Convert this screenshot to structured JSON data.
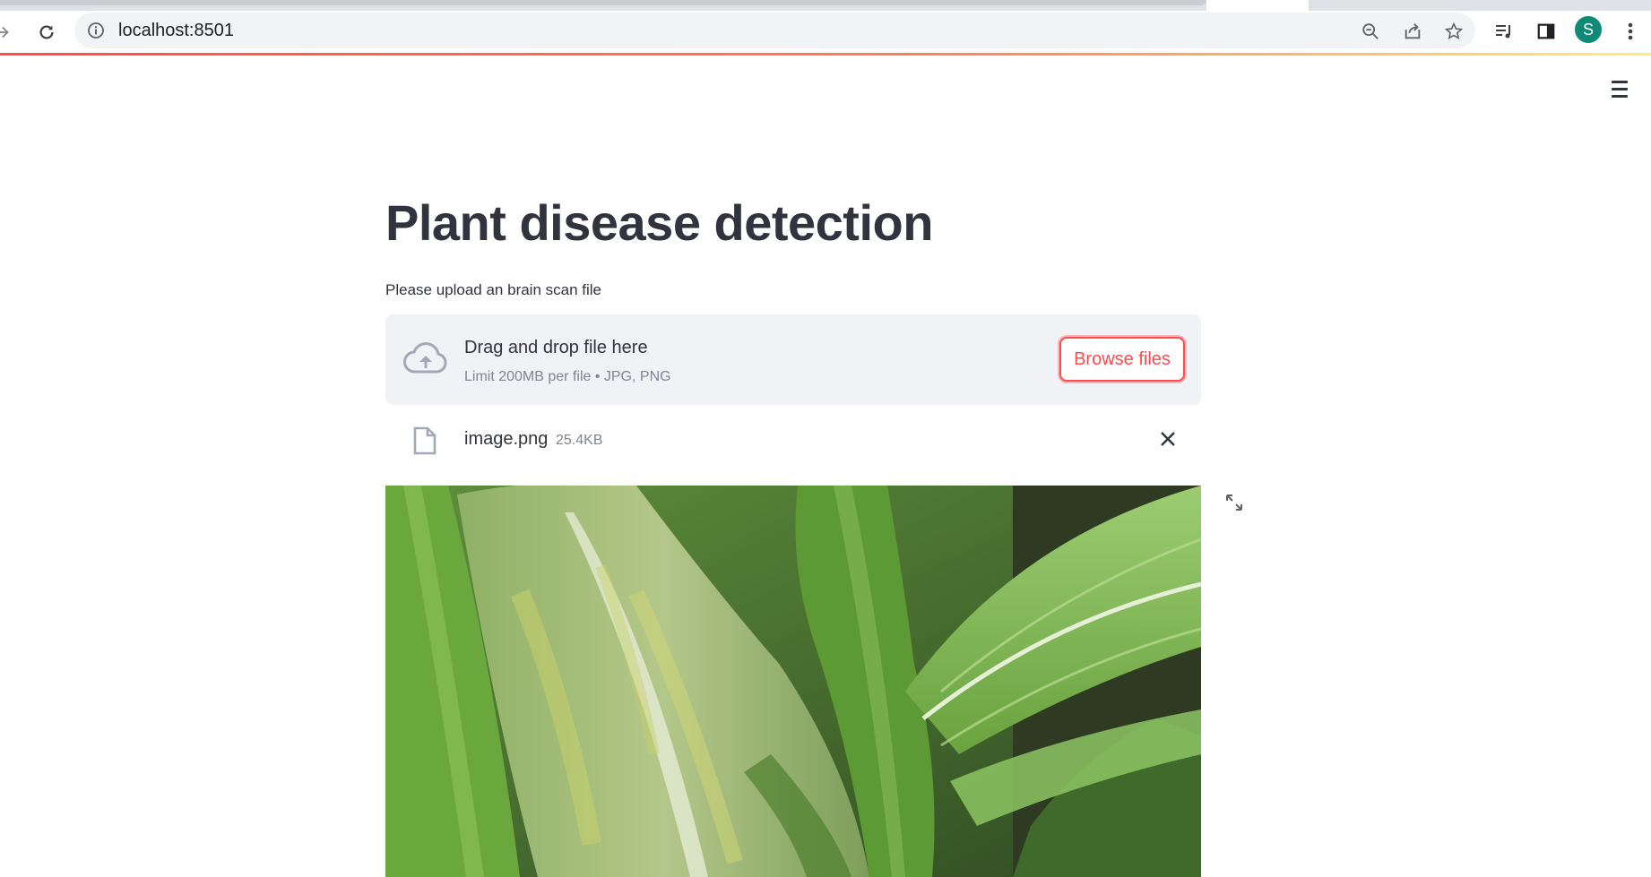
{
  "browser": {
    "url": "localhost:8501",
    "profile_initial": "S"
  },
  "app": {
    "title": "Plant disease detection",
    "upload_label": "Please upload an brain scan file",
    "dropzone": {
      "main_text": "Drag and drop file here",
      "limit_text": "Limit 200MB per file • JPG, PNG",
      "browse_label": "Browse files"
    },
    "file": {
      "name": "image.png",
      "size": "25.4KB"
    }
  },
  "colors": {
    "accent": "#ff4b4b",
    "text": "#31333f",
    "muted": "#808495",
    "dropzone_bg": "#f0f2f6",
    "avatar": "#0e8a77"
  }
}
